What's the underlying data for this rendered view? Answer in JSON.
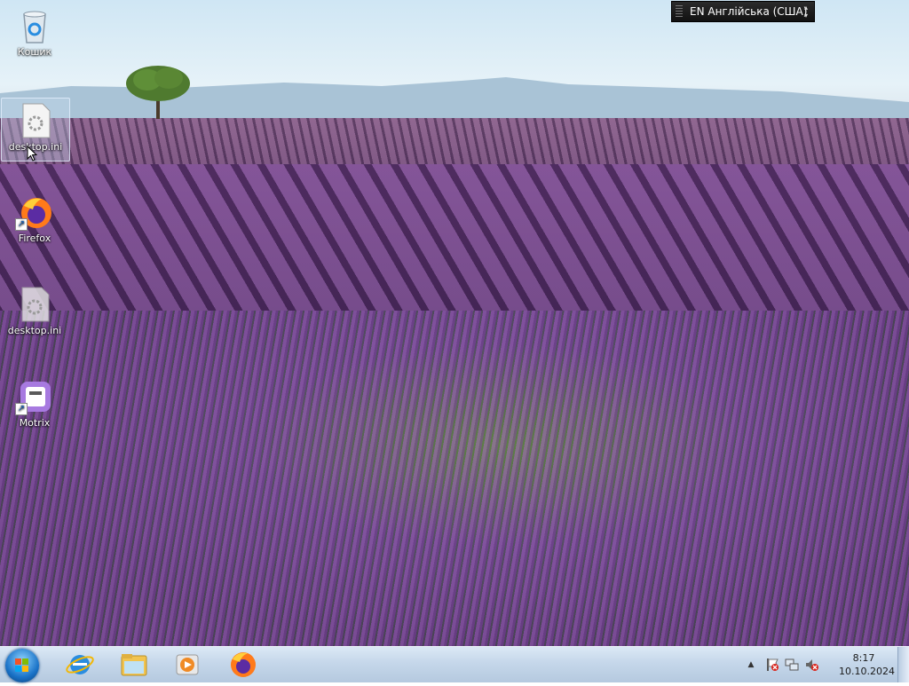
{
  "desktop": {
    "icons": [
      {
        "label": "Кошик",
        "icon": "recycle-bin-icon"
      },
      {
        "label": "desktop.ini",
        "icon": "settings-file-icon"
      },
      {
        "label": "Firefox",
        "icon": "firefox-icon"
      },
      {
        "label": "desktop.ini",
        "icon": "settings-file-icon"
      },
      {
        "label": "Motrix",
        "icon": "motrix-icon"
      }
    ]
  },
  "language_bar": {
    "text": "EN Англійська (США)"
  },
  "taskbar": {
    "pinned": [
      "internet-explorer-icon",
      "file-explorer-icon",
      "media-player-icon",
      "firefox-icon"
    ],
    "tray": {
      "time": "8:17",
      "date": "10.10.2024"
    }
  },
  "colors": {
    "taskbar": "#c5d7ea",
    "lavender": "#6b4690"
  }
}
